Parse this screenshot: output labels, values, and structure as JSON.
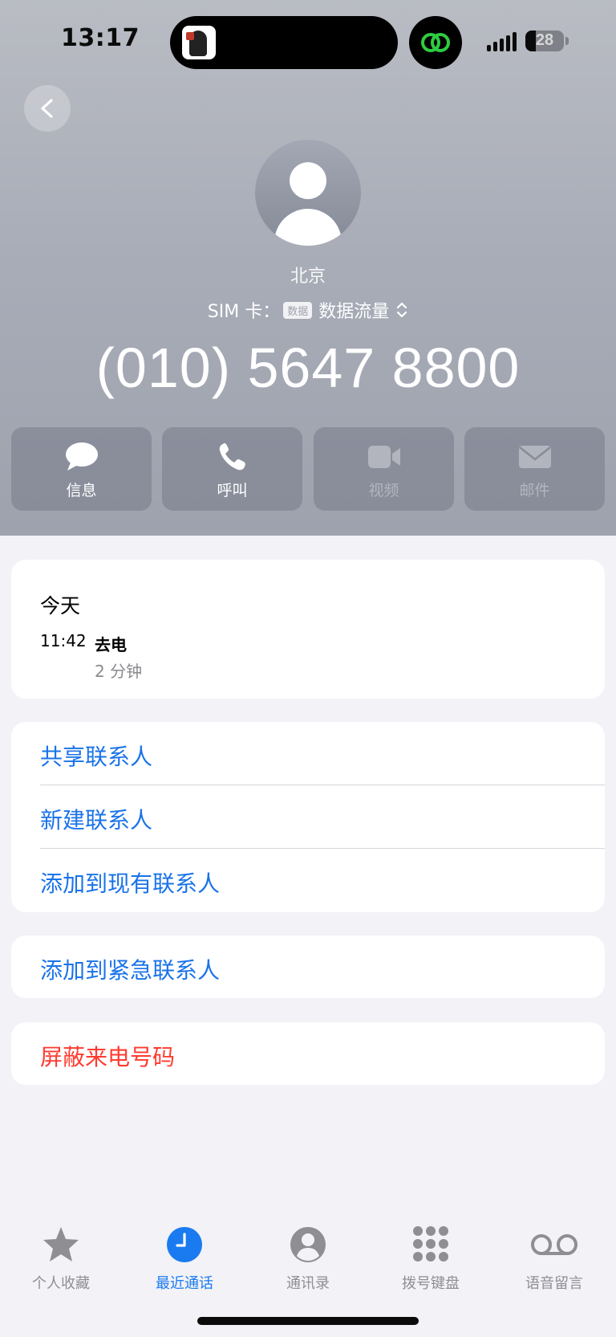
{
  "status_bar": {
    "time": "13:17",
    "battery_level": "28",
    "battery_fraction": 0.28
  },
  "contact": {
    "label": "北京",
    "sim_prefix": "SIM 卡：",
    "sim_badge": "数据",
    "sim_line": "数据流量",
    "phone_number": "(010) 5647 8800"
  },
  "actions": [
    {
      "label": "信息",
      "icon": "message-icon",
      "enabled": true
    },
    {
      "label": "呼叫",
      "icon": "phone-icon",
      "enabled": true
    },
    {
      "label": "视频",
      "icon": "video-icon",
      "enabled": false
    },
    {
      "label": "邮件",
      "icon": "mail-icon",
      "enabled": false
    }
  ],
  "history": {
    "date": "今天",
    "time": "11:42",
    "type": "去电",
    "duration": "2 分钟"
  },
  "options": {
    "share_contact": "共享联系人",
    "new_contact": "新建联系人",
    "add_existing": "添加到现有联系人",
    "add_emergency": "添加到紧急联系人",
    "block_caller": "屏蔽来电号码"
  },
  "tabs": [
    {
      "label": "个人收藏",
      "icon": "star-icon",
      "active": false
    },
    {
      "label": "最近通话",
      "icon": "clock-icon",
      "active": true
    },
    {
      "label": "通讯录",
      "icon": "person-circle-icon",
      "active": false
    },
    {
      "label": "拨号键盘",
      "icon": "keypad-icon",
      "active": false
    },
    {
      "label": "语音留言",
      "icon": "voicemail-icon",
      "active": false
    }
  ],
  "colors": {
    "accent": "#1a7bf0",
    "link": "#1a73e8",
    "destructive": "#ff3b30",
    "inactive_tab": "#8e8e93"
  }
}
